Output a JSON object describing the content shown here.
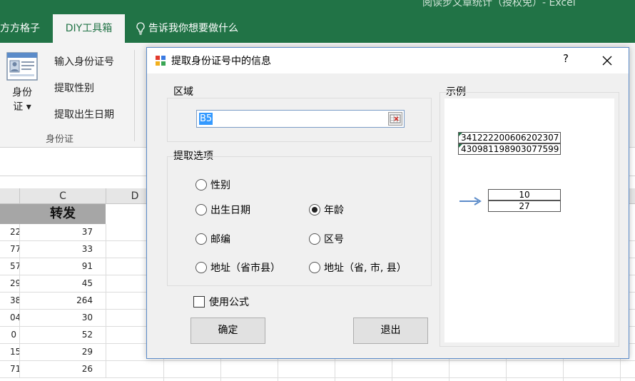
{
  "ribbon": {
    "window_title_partial": "阅读步文章统计（授权免）- Excel",
    "tabs": {
      "left": "方方格子",
      "diy": "DIY工具箱",
      "tell": "告诉我你想要做什么"
    },
    "big_button_line1": "身份",
    "big_button_line2": "证 ▾",
    "items": [
      "输入身份证号",
      "提取性别",
      "提取出生日期"
    ],
    "group_label": "身份证"
  },
  "sheet": {
    "columns": [
      "C",
      "D"
    ],
    "header_cell": "转发",
    "rows": [
      {
        "b": "22",
        "c": "37"
      },
      {
        "b": "77",
        "c": "33"
      },
      {
        "b": "57",
        "c": "91"
      },
      {
        "b": "29",
        "c": "45"
      },
      {
        "b": "38",
        "c": "264"
      },
      {
        "b": "04",
        "c": "30"
      },
      {
        "b": "0",
        "c": "52"
      },
      {
        "b": "15",
        "c": "29"
      },
      {
        "b": "71",
        "c": "26"
      }
    ]
  },
  "dialog": {
    "title": "提取身份证号中的信息",
    "help": "?",
    "area": {
      "label": "区域",
      "value": "B5"
    },
    "options": {
      "label": "提取选项",
      "gender": "性别",
      "birthdate": "出生日期",
      "age": "年龄",
      "postcode": "邮编",
      "area_code": "区号",
      "address1": "地址（省市县）",
      "address2": "地址（省, 市, 县）",
      "selected": "age"
    },
    "use_formula": "使用公式",
    "ok": "确定",
    "quit": "退出",
    "example": {
      "label": "示例",
      "ids": [
        "341222200606202307",
        "430981198903077599"
      ],
      "results": [
        "10",
        "27"
      ]
    }
  },
  "colors": {
    "excel_green": "#217346",
    "dialog_border": "#5b8bc9",
    "arrow": "#5b8bc9"
  }
}
